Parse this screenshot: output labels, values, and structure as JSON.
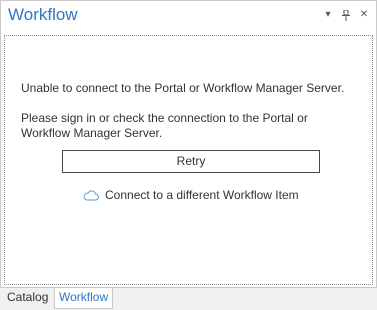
{
  "window": {
    "title": "Workflow",
    "controls": {
      "menu_glyph": "▾",
      "pin_glyph": "⊥",
      "close_glyph": "✕"
    }
  },
  "main": {
    "error_message": "Unable to connect to the Portal or Workflow Manager Server.",
    "hint_message": "Please sign in or check the connection to the Portal or Workflow Manager Server.",
    "retry_label": "Retry",
    "connect_label": "Connect to a different Workflow Item",
    "connect_icon": "cloud-icon"
  },
  "tabs": [
    {
      "label": "Catalog",
      "active": false
    },
    {
      "label": "Workflow",
      "active": true
    }
  ],
  "colors": {
    "accent": "#2b78c4",
    "text": "#333333",
    "border": "#c9c9c9",
    "tabbar_bg": "#f0f0f0"
  }
}
